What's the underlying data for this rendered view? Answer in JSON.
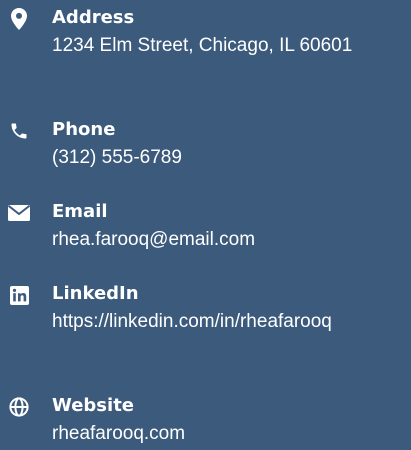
{
  "theme": {
    "background": "#3b5a7c",
    "text": "#ffffff"
  },
  "contact": {
    "address": {
      "icon": "map-marker-icon",
      "label": "Address",
      "value": "1234 Elm Street, Chicago, IL 60601"
    },
    "phone": {
      "icon": "phone-icon",
      "label": "Phone",
      "value": "(312) 555-6789"
    },
    "email": {
      "icon": "envelope-icon",
      "label": "Email",
      "value": "rhea.farooq@email.com"
    },
    "linkedin": {
      "icon": "linkedin-icon",
      "label": "LinkedIn",
      "value": "https://linkedin.com/in/rheafarooq"
    },
    "website": {
      "icon": "globe-icon",
      "label": "Website",
      "value": "rheafarooq.com"
    }
  }
}
